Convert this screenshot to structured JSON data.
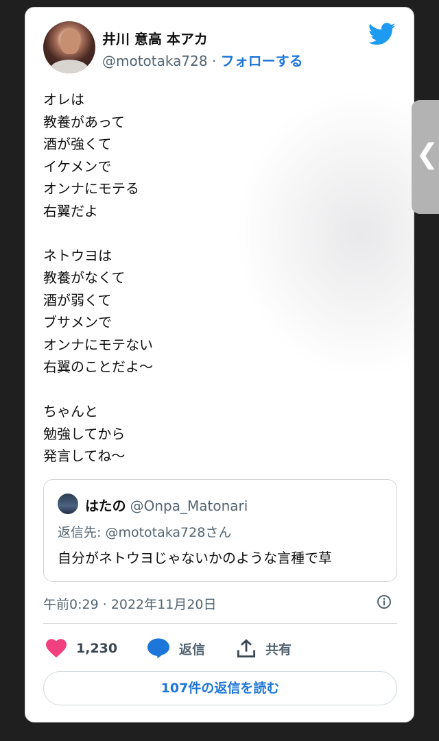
{
  "author": {
    "name": "井川 意高 本アカ",
    "handle": "@mototaka728",
    "separator": "·",
    "follow_label": "フォローする"
  },
  "tweet_lines": [
    "オレは",
    "教養があって",
    "酒が強くて",
    "イケメンで",
    "オンナにモテる",
    "右翼だよ",
    "",
    "ネトウヨは",
    "教養がなくて",
    "酒が弱くて",
    "ブサメンで",
    "オンナにモテない",
    "右翼のことだよ〜",
    "",
    "ちゃんと",
    "勉強してから",
    "発言してね〜"
  ],
  "quote": {
    "name": "はたの",
    "handle": "@Onpa_Matonari",
    "reply_to": "返信先: @mototaka728さん",
    "text": "自分がネトウヨじゃないかのような言種で草"
  },
  "timestamp": "午前0:29 · 2022年11月20日",
  "actions": {
    "like_count": "1,230",
    "reply_label": "返信",
    "share_label": "共有"
  },
  "read_replies_label": "107件の返信を読む",
  "side_tab_glyph": "❮",
  "colors": {
    "accent": "#1d77d8",
    "twitter_blue": "#1d9bf0",
    "like": "#f0407f",
    "secondary_text": "#536471"
  }
}
